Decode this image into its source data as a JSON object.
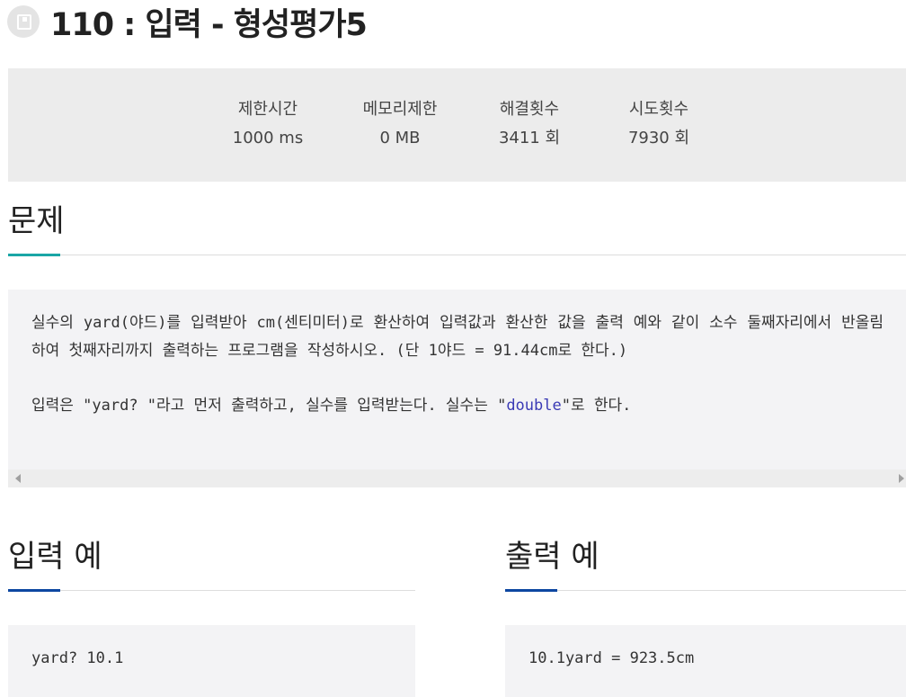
{
  "header": {
    "title": "110 : 입력 - 형성평가5"
  },
  "info": [
    {
      "label": "제한시간",
      "value": "1000 ms"
    },
    {
      "label": "메모리제한",
      "value": "0 MB"
    },
    {
      "label": "해결횟수",
      "value": "3411 회"
    },
    {
      "label": "시도횟수",
      "value": "7930 회"
    }
  ],
  "problem": {
    "heading": "문제",
    "paragraph1": "실수의 yard(야드)를 입력받아 cm(센티미터)로 환산하여 입력값과 환산한 값을 출력 예와 같이 소수 둘째자리에서 반올림하여 첫째자리까지 출력하는 프로그램을 작성하시오. (단 1야드 = 91.44cm로 한다.)",
    "paragraph2_before": "입력은 \"yard? \"라고 먼저 출력하고, 실수를 입력받는다.  실수는 \"",
    "paragraph2_keyword": "double",
    "paragraph2_after": "\"로 한다."
  },
  "sample_input": {
    "heading": "입력 예",
    "text": "yard? 10.1"
  },
  "sample_output": {
    "heading": "출력 예",
    "text": "10.1yard = 923.5cm"
  },
  "colors": {
    "problem_accent": "#1aa6a6",
    "sample_accent": "#0d47a1",
    "keyword": "#3a3ab5"
  },
  "icons": {
    "title": "problem-icon",
    "scroll_left": "arrow-left-icon",
    "scroll_right": "arrow-right-icon"
  }
}
